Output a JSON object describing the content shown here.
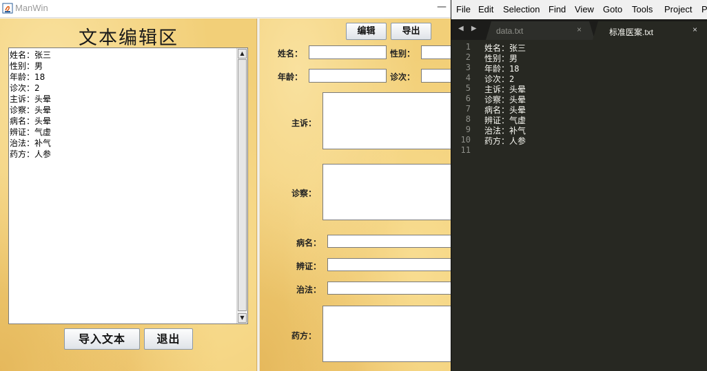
{
  "java_window": {
    "title": "ManWin",
    "minimize": "—",
    "left_panel": {
      "title": "文本编辑区",
      "text_lines": [
        "姓名：张三",
        "性别：男",
        "年龄：18",
        "诊次：2",
        "主诉：头晕",
        "诊察：头晕",
        "病名：头晕",
        "辨证：气虚",
        "治法：补气",
        "药方：人参"
      ],
      "import_button": "导入文本",
      "exit_button": "退出"
    },
    "right_panel": {
      "edit_button": "编辑",
      "export_button": "导出",
      "labels": {
        "name": "姓名：",
        "gender": "性别：",
        "age": "年龄：",
        "visit": "诊次：",
        "complaint": "主诉：",
        "exam": "诊察：",
        "disease": "病名：",
        "syndrome": "辨证：",
        "treatment": "治法：",
        "prescription": "药方："
      }
    }
  },
  "sublime": {
    "menu": [
      "File",
      "Edit",
      "Selection",
      "Find",
      "View",
      "Goto",
      "Tools",
      "Project",
      "Pr"
    ],
    "nav": "◀ ▶",
    "tabs": [
      {
        "label": "data.txt",
        "close": "×"
      },
      {
        "label": "标准医案.txt",
        "close": "×"
      }
    ],
    "line_numbers": [
      "1",
      "2",
      "3",
      "4",
      "5",
      "6",
      "7",
      "8",
      "9",
      "10",
      "11"
    ],
    "lines": [
      "姓名：张三",
      "性别：男",
      "年龄：18",
      "诊次：2",
      "主诉：头晕",
      "诊察：头晕",
      "病名：头晕",
      "辨证：气虚",
      "治法：补气",
      "药方：人参",
      ""
    ],
    "colors": {
      "background": "#272822",
      "text": "#f8f8f2",
      "gutter": "#8f908a"
    }
  }
}
